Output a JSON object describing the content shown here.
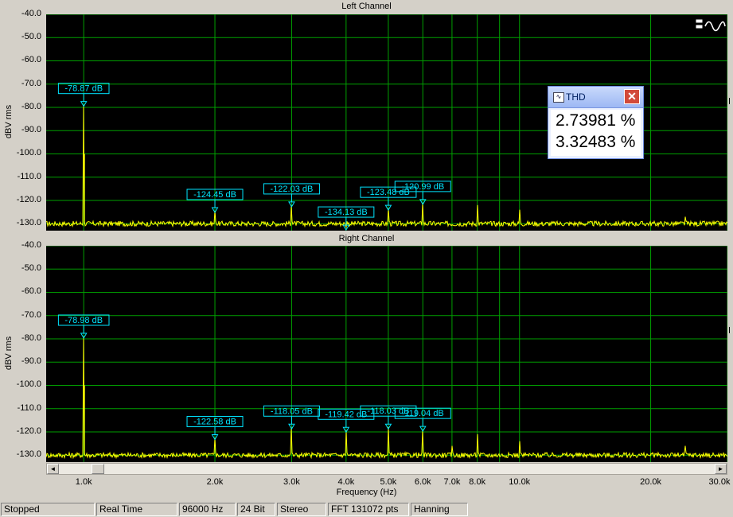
{
  "chart_data": [
    {
      "type": "line",
      "title": "Left Channel",
      "ylabel": "dBV rms",
      "xlabel": "",
      "xscale": "log",
      "xlim": [
        820,
        30000
      ],
      "ylim": [
        -133,
        -40
      ],
      "grid": true,
      "yticks": [
        -40,
        -50,
        -60,
        -70,
        -80,
        -90,
        -100,
        -110,
        -120,
        -130
      ],
      "ytick_labels": [
        "-40.0",
        "-50.0",
        "-60.0",
        "-70.0",
        "-80.0",
        "-90.0",
        "-100.0",
        "-110.0",
        "-120.0",
        "-130.0"
      ],
      "line_color": "#ffff00",
      "noise_floor": -130,
      "peaks": [
        {
          "x": 1000,
          "y": -78.87,
          "label": "-78.87 dB"
        },
        {
          "x": 2000,
          "y": -124.45,
          "label": "-124.45 dB"
        },
        {
          "x": 3000,
          "y": -122.03,
          "label": "-122.03 dB"
        },
        {
          "x": 4000,
          "y": -134.13,
          "label": "-134.13 dB"
        },
        {
          "x": 5000,
          "y": -123.48,
          "label": "-123.48 dB"
        },
        {
          "x": 6000,
          "y": -120.99,
          "label": "-120.99 dB"
        }
      ],
      "minor_peaks": [
        {
          "x": 8000,
          "y": -122
        },
        {
          "x": 10000,
          "y": -124
        },
        {
          "x": 24000,
          "y": -127
        }
      ]
    },
    {
      "type": "line",
      "title": "Right Channel",
      "ylabel": "dBV rms",
      "xlabel": "Frequency (Hz)",
      "xscale": "log",
      "xlim": [
        820,
        30000
      ],
      "ylim": [
        -133,
        -40
      ],
      "grid": true,
      "yticks": [
        -40,
        -50,
        -60,
        -70,
        -80,
        -90,
        -100,
        -110,
        -120,
        -130
      ],
      "ytick_labels": [
        "-40.0",
        "-50.0",
        "-60.0",
        "-70.0",
        "-80.0",
        "-90.0",
        "-100.0",
        "-110.0",
        "-120.0",
        "-130.0"
      ],
      "xticks": [
        1000,
        2000,
        3000,
        4000,
        5000,
        6000,
        7000,
        8000,
        10000,
        20000,
        30000
      ],
      "xtick_labels": [
        "1.0k",
        "2.0k",
        "3.0k",
        "4.0k",
        "5.0k",
        "6.0k",
        "7.0k",
        "8.0k",
        "10.0k",
        "20.0k",
        "30.0k"
      ],
      "line_color": "#ffff00",
      "noise_floor": -130,
      "peaks": [
        {
          "x": 1000,
          "y": -78.98,
          "label": "-78.98 dB"
        },
        {
          "x": 2000,
          "y": -122.58,
          "label": "-122.58 dB"
        },
        {
          "x": 3000,
          "y": -118.05,
          "label": "-118.05 dB"
        },
        {
          "x": 4000,
          "y": -119.42,
          "label": "-119.42 dB"
        },
        {
          "x": 5000,
          "y": -118.03,
          "label": "-118.03 dB"
        },
        {
          "x": 6000,
          "y": -119.04,
          "label": "-119.04 dB"
        }
      ],
      "minor_peaks": [
        {
          "x": 7000,
          "y": -126
        },
        {
          "x": 8000,
          "y": -121
        },
        {
          "x": 10000,
          "y": -124
        },
        {
          "x": 24000,
          "y": -126
        }
      ]
    }
  ],
  "thd": {
    "title": "THD",
    "close_glyph": "✕",
    "left_value": "2.73981 %",
    "right_value": "3.32483 %"
  },
  "status": {
    "state": "Stopped",
    "mode": "Real Time",
    "sample_rate": "96000 Hz",
    "bit_depth": "24 Bit",
    "channels": "Stereo",
    "fft": "FFT 131072 pts",
    "window": "Hanning"
  },
  "colors": {
    "plot_bg": "#000000",
    "grid": "#00a000",
    "trace": "#ffff00",
    "marker": "#00e5ff"
  }
}
